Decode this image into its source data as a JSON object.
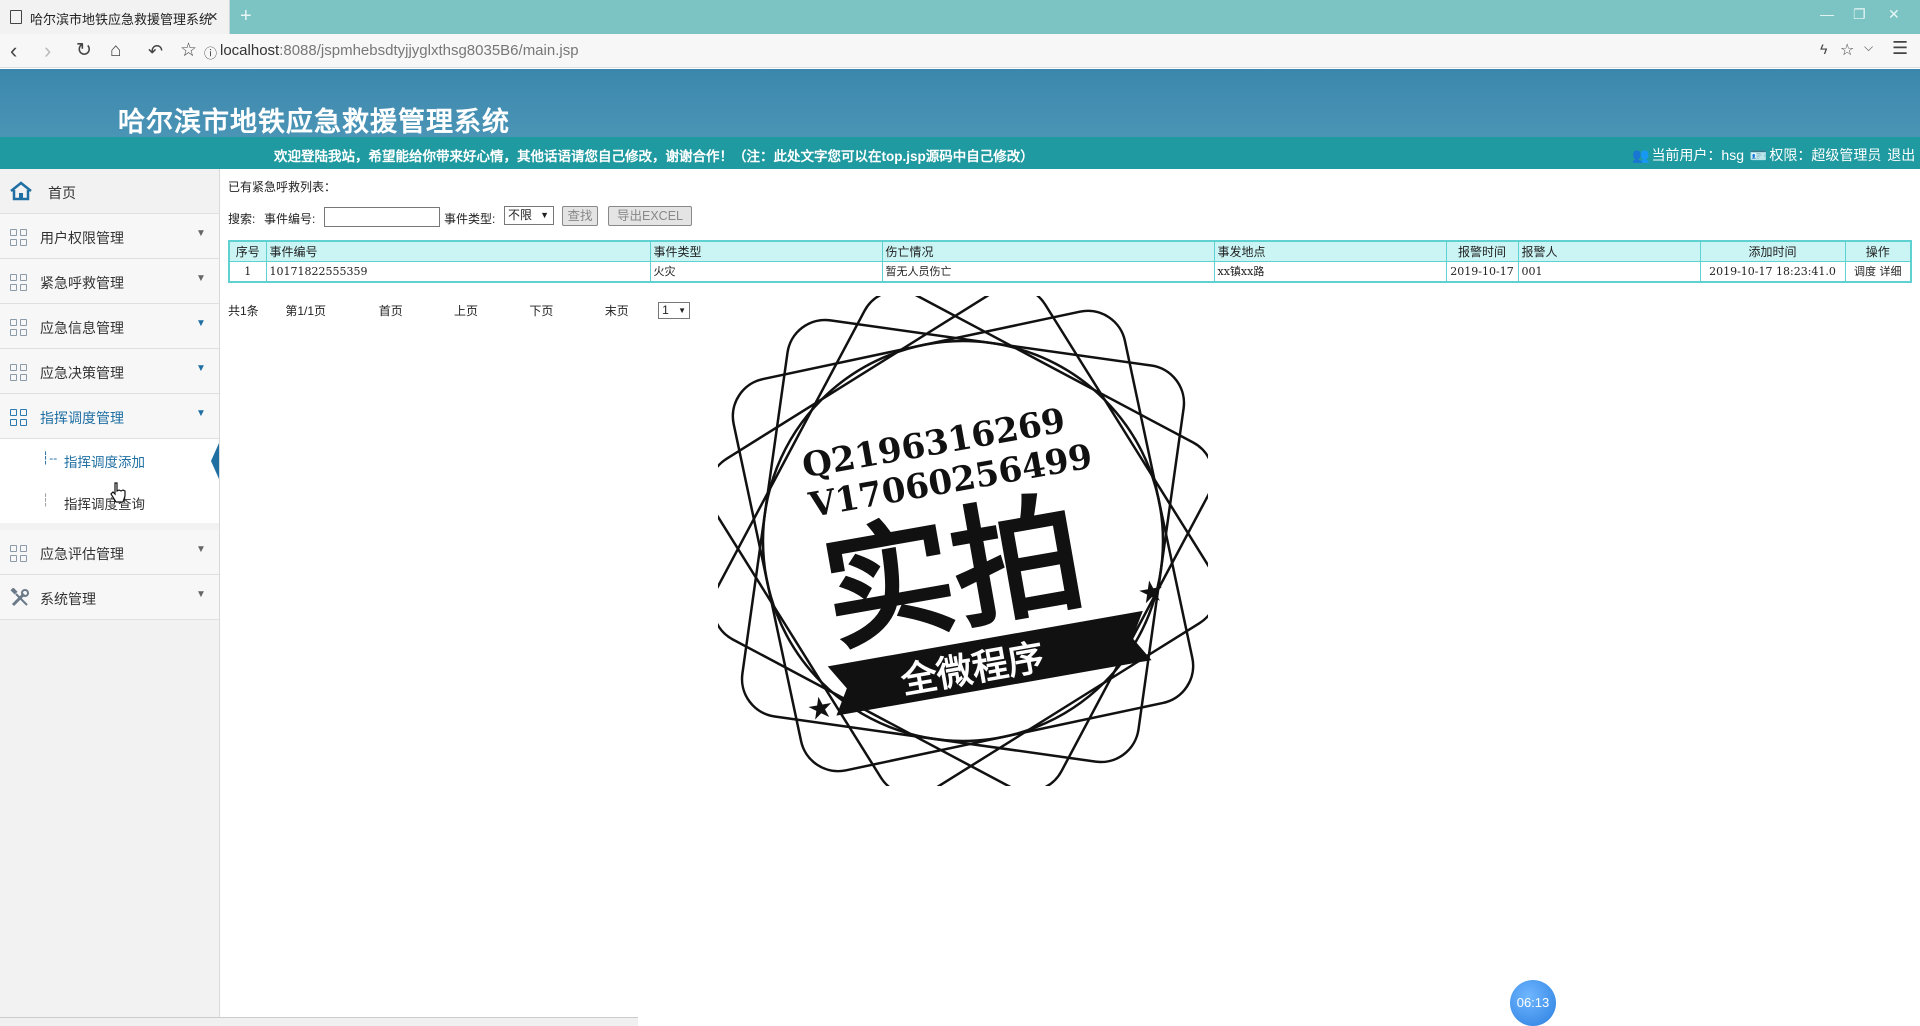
{
  "browser": {
    "tab_title": "哈尔滨市地铁应急救援管理系统",
    "tab_close": "×",
    "new_tab": "+",
    "url_host": "localhost",
    "url_rest": ":8088/jspmhebsdtyjjyglxthsg8035B6/main.jsp"
  },
  "header": {
    "title": "哈尔滨市地铁应急救援管理系统",
    "welcome": "欢迎登陆我站，希望能给你带来好心情，其他话语请您自己修改，谢谢合作！（注：此处文字您可以在top.jsp源码中自己修改）",
    "current_user_label": "当前用户：hsg",
    "role_label": "权限：超级管理员",
    "logout": "退出"
  },
  "sidebar": {
    "items": [
      {
        "label": "首页"
      },
      {
        "label": "用户权限管理"
      },
      {
        "label": "紧急呼救管理"
      },
      {
        "label": "应急信息管理"
      },
      {
        "label": "应急决策管理"
      },
      {
        "label": "指挥调度管理"
      },
      {
        "label": "应急评估管理"
      },
      {
        "label": "系统管理"
      }
    ],
    "submenu": [
      {
        "label": "指挥调度添加"
      },
      {
        "label": "指挥调度查询"
      }
    ]
  },
  "main": {
    "list_title": "已有紧急呼救列表：",
    "search_label": "搜索:",
    "event_no_label": "事件编号:",
    "event_no_value": "",
    "event_type_label": "事件类型:",
    "event_type_selected": "不限",
    "search_button": "查找",
    "export_button": "导出EXCEL",
    "columns": [
      "序号",
      "事件编号",
      "事件类型",
      "伤亡情况",
      "事发地点",
      "报警时间",
      "报警人",
      "添加时间",
      "操作"
    ],
    "rows": [
      [
        "1",
        "10171822555359",
        "火灾",
        "暂无人员伤亡",
        "xx镇xx路",
        "2019-10-17",
        "001",
        "2019-10-17 18:23:41.0"
      ]
    ],
    "row_actions": [
      "调度",
      "详细"
    ],
    "pager": {
      "total": "共1条",
      "page_info": "第1/1页",
      "first": "首页",
      "prev": "上页",
      "next": "下页",
      "last": "末页",
      "page_select": "1"
    }
  },
  "stamp": {
    "line1": "Q2196316269",
    "line2": "V17060256499",
    "big": "实拍",
    "ribbon": "全微程序"
  },
  "timer": "06:13"
}
